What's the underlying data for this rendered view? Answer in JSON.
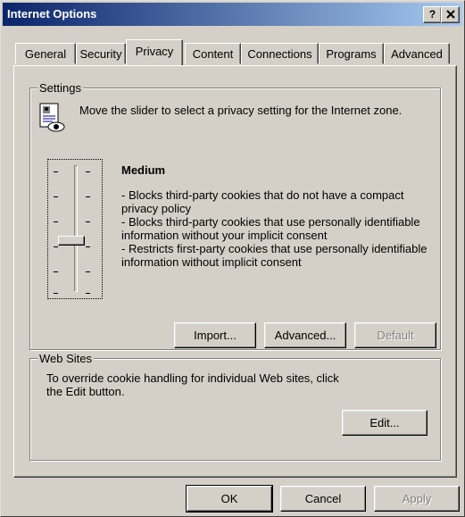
{
  "window": {
    "title": "Internet Options",
    "help_glyph": "?",
    "close_glyph": "X"
  },
  "tabs": [
    {
      "label": "General"
    },
    {
      "label": "Security"
    },
    {
      "label": "Privacy",
      "active": true
    },
    {
      "label": "Content"
    },
    {
      "label": "Connections"
    },
    {
      "label": "Programs"
    },
    {
      "label": "Advanced"
    }
  ],
  "settings": {
    "legend": "Settings",
    "intro": "Move the slider to select a privacy setting for the Internet zone.",
    "slider_level": "Medium",
    "slider_level_value": 3,
    "slider_levels_total": 6,
    "description": [
      "- Blocks third-party cookies that do not have a compact privacy policy",
      "- Blocks third-party cookies that use personally identifiable information without your implicit consent",
      "- Restricts first-party cookies that use personally identifiable information without implicit consent"
    ],
    "buttons": {
      "import": "Import...",
      "advanced": "Advanced...",
      "default": "Default"
    }
  },
  "websites": {
    "legend": "Web Sites",
    "text": "To override cookie handling for individual Web sites, click the Edit button.",
    "edit": "Edit..."
  },
  "footer": {
    "ok": "OK",
    "cancel": "Cancel",
    "apply": "Apply"
  },
  "icons": {
    "privacy": "privacy-document-icon"
  }
}
